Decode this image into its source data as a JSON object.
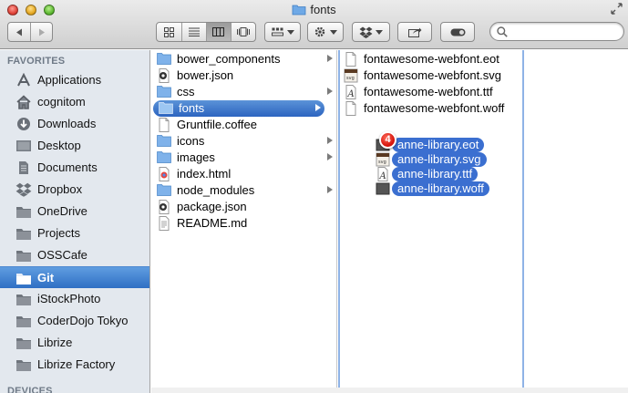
{
  "window": {
    "title": "fonts"
  },
  "toolbar": {
    "view_icons": [
      "icon-view-icon",
      "list-view-icon",
      "column-view-icon",
      "coverflow-view-icon"
    ],
    "active_view": "column"
  },
  "sidebar": {
    "favorites_header": "FAVORITES",
    "devices_header": "DEVICES",
    "items": [
      {
        "label": "Applications",
        "icon": "applications-icon"
      },
      {
        "label": "cognitom",
        "icon": "home-icon"
      },
      {
        "label": "Downloads",
        "icon": "downloads-icon"
      },
      {
        "label": "Desktop",
        "icon": "desktop-icon"
      },
      {
        "label": "Documents",
        "icon": "documents-icon"
      },
      {
        "label": "Dropbox",
        "icon": "dropbox-icon"
      },
      {
        "label": "OneDrive",
        "icon": "folder-icon"
      },
      {
        "label": "Projects",
        "icon": "folder-icon"
      },
      {
        "label": "OSSCafe",
        "icon": "folder-icon"
      },
      {
        "label": "Git",
        "icon": "folder-icon",
        "selected": true
      },
      {
        "label": "iStockPhoto",
        "icon": "folder-icon"
      },
      {
        "label": "CoderDojo Tokyo",
        "icon": "folder-icon"
      },
      {
        "label": "Librize",
        "icon": "folder-icon"
      },
      {
        "label": "Librize Factory",
        "icon": "folder-icon"
      }
    ]
  },
  "column1": {
    "items": [
      {
        "label": "bower_components",
        "type": "folder",
        "has_children": true
      },
      {
        "label": "bower.json",
        "type": "json"
      },
      {
        "label": "css",
        "type": "folder",
        "has_children": true
      },
      {
        "label": "fonts",
        "type": "folder",
        "has_children": true,
        "selected": true
      },
      {
        "label": "Gruntfile.coffee",
        "type": "file"
      },
      {
        "label": "icons",
        "type": "folder",
        "has_children": true
      },
      {
        "label": "images",
        "type": "folder",
        "has_children": true
      },
      {
        "label": "index.html",
        "type": "html"
      },
      {
        "label": "node_modules",
        "type": "folder",
        "has_children": true
      },
      {
        "label": "package.json",
        "type": "json"
      },
      {
        "label": "README.md",
        "type": "doc"
      }
    ]
  },
  "column2": {
    "items": [
      {
        "label": "fontawesome-webfont.eot",
        "type": "file"
      },
      {
        "label": "fontawesome-webfont.svg",
        "type": "svg"
      },
      {
        "label": "fontawesome-webfont.ttf",
        "type": "ttf"
      },
      {
        "label": "fontawesome-webfont.woff",
        "type": "file"
      }
    ]
  },
  "drag": {
    "badge_count": "4",
    "items": [
      {
        "label": "anne-library.eot",
        "type": "eot"
      },
      {
        "label": "anne-library.svg",
        "type": "svg"
      },
      {
        "label": "anne-library.ttf",
        "type": "ttf"
      },
      {
        "label": "anne-library.woff",
        "type": "woff"
      }
    ]
  },
  "colors": {
    "selection": "#2f6fc4",
    "sidebar_bg": "#e3e8ee",
    "badge": "#d5140c"
  }
}
